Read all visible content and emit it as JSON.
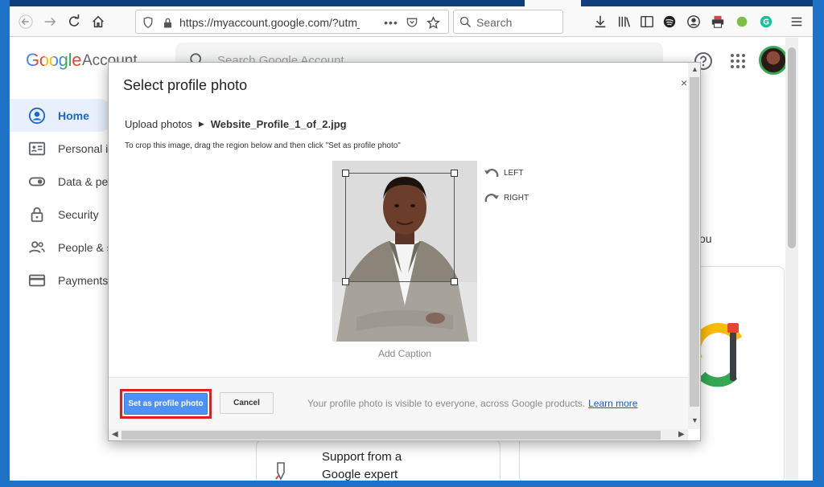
{
  "browser": {
    "url": "https://myaccount.google.com/?utm_so",
    "search_placeholder": "Search"
  },
  "google": {
    "logo": "Google",
    "account": "Account",
    "search_placeholder": "Search Google Account",
    "nav": [
      {
        "label": "Home",
        "icon": "account-circle-icon"
      },
      {
        "label": "Personal i",
        "icon": "id-card-icon"
      },
      {
        "label": "Data & pe",
        "icon": "toggle-icon"
      },
      {
        "label": "Security",
        "icon": "lock-icon"
      },
      {
        "label": "People & s",
        "icon": "people-icon"
      },
      {
        "label": "Payments",
        "icon": "credit-card-icon"
      }
    ],
    "right_snippet": "ou",
    "support_title": "Support from a Google expert"
  },
  "modal": {
    "title": "Select profile photo",
    "close": "×",
    "crumb_parent": "Upload photos",
    "crumb_file": "Website_Profile_1_of_2.jpg",
    "instructions": "To crop this image, drag the region below and then click \"Set as profile photo\"",
    "rotate_left": "LEFT",
    "rotate_right": "RIGHT",
    "caption_placeholder": "Add Caption",
    "primary_button": "Set as profile photo",
    "cancel_button": "Cancel",
    "visibility_note": "Your profile photo is visible to everyone, across Google products.",
    "learn_more": "Learn more"
  },
  "colors": {
    "accent_blue": "#4d90fe",
    "highlight_red": "#e02020",
    "frame_blue": "#1e73c8"
  }
}
